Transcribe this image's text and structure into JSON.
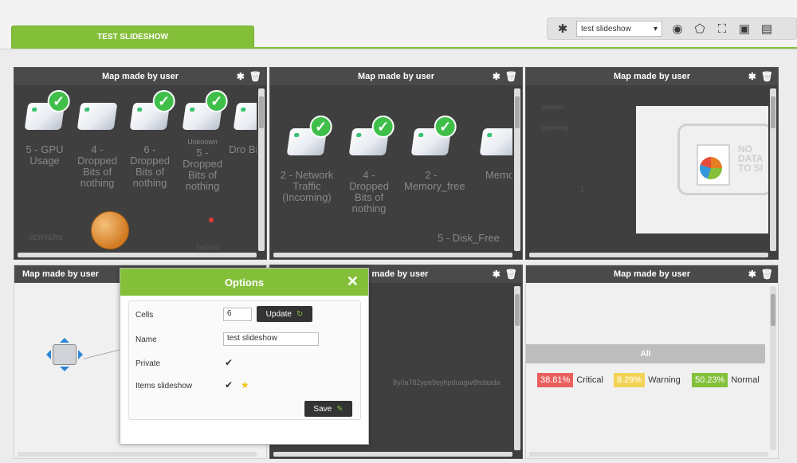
{
  "tab": {
    "label": "TEST SLIDESHOW"
  },
  "toolbar": {
    "select_value": "test slideshow",
    "icons": [
      "gear-icon",
      "camera-icon",
      "tag-icon",
      "fullscreen-icon",
      "save-icon",
      "list-icon"
    ]
  },
  "panels": [
    {
      "title": "Map made by user"
    },
    {
      "title": "Map made by user"
    },
    {
      "title": "Map made by user"
    },
    {
      "title": "Map made by user"
    },
    {
      "title": "p made by user"
    },
    {
      "title": "Map made by user"
    }
  ],
  "map1": {
    "nodes": [
      {
        "label": "5 - GPU Usage",
        "sub": ""
      },
      {
        "label": "4 - Dropped Bits of nothing",
        "sub": ""
      },
      {
        "label": "6 - Dropped Bits of nothing",
        "sub": ""
      },
      {
        "label": "5 - Dropped Bits of nothing",
        "sub": "Unknown"
      },
      {
        "label": "Dro Bit not",
        "sub": ""
      }
    ],
    "servers_label": "SERVERS",
    "small_label": "sadasd"
  },
  "map2": {
    "nodes": [
      {
        "label": "2 - Network Traffic (Incoming)"
      },
      {
        "label": "4 - Dropped Bits of nothing"
      },
      {
        "label": "2 - Memory_free"
      },
      {
        "label": "Memo"
      }
    ],
    "bottom_label": "5 - Disk_Free"
  },
  "map3": {
    "labels": [
      "pepiso",
      "gweweg",
      "1"
    ],
    "nodata": [
      "NO",
      "DATA",
      "TO SI"
    ]
  },
  "map5": {
    "hash": "8y0a782ype9eyhpduagw8hdasda"
  },
  "map6": {
    "all_label": "All",
    "stats": [
      {
        "pct": "38.81%",
        "label": "Critical",
        "color": "#e95f5f"
      },
      {
        "pct": "8.29%",
        "label": "Warning",
        "color": "#f3d356"
      },
      {
        "pct": "50.23%",
        "label": "Normal",
        "color": "#84bf3a"
      }
    ]
  },
  "modal": {
    "title": "Options",
    "cells_label": "Cells",
    "cells_value": "6",
    "update_label": "Update",
    "name_label": "Name",
    "name_value": "test slideshow",
    "private_label": "Private",
    "items_label": "Items slideshow",
    "save_label": "Save"
  }
}
